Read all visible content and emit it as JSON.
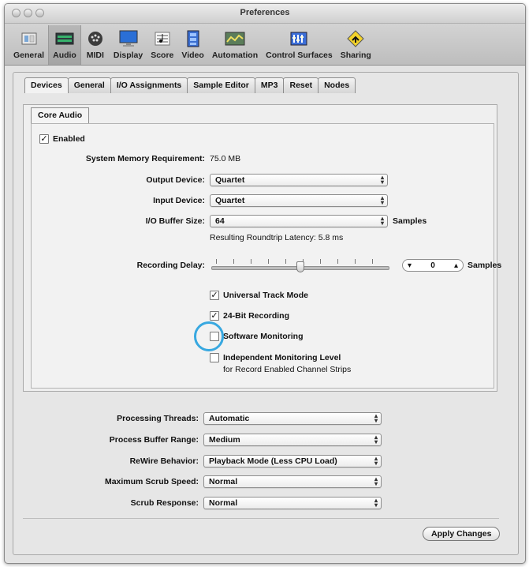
{
  "window": {
    "title": "Preferences"
  },
  "toolbar": {
    "items": [
      {
        "label": "General",
        "icon": "general-icon"
      },
      {
        "label": "Audio",
        "icon": "audio-icon",
        "selected": true
      },
      {
        "label": "MIDI",
        "icon": "midi-icon"
      },
      {
        "label": "Display",
        "icon": "display-icon"
      },
      {
        "label": "Score",
        "icon": "score-icon"
      },
      {
        "label": "Video",
        "icon": "video-icon"
      },
      {
        "label": "Automation",
        "icon": "automation-icon"
      },
      {
        "label": "Control Surfaces",
        "icon": "control-surfaces-icon"
      },
      {
        "label": "Sharing",
        "icon": "sharing-icon"
      }
    ]
  },
  "tabs": [
    {
      "label": "Devices",
      "active": true
    },
    {
      "label": "General"
    },
    {
      "label": "I/O Assignments"
    },
    {
      "label": "Sample Editor"
    },
    {
      "label": "MP3"
    },
    {
      "label": "Reset"
    },
    {
      "label": "Nodes"
    }
  ],
  "core_audio": {
    "tab_label": "Core Audio",
    "enabled_label": "Enabled",
    "enabled_checked": true,
    "memory_label": "System Memory Requirement:",
    "memory_value": "75.0 MB",
    "output_device_label": "Output Device:",
    "output_device_value": "Quartet",
    "input_device_label": "Input Device:",
    "input_device_value": "Quartet",
    "buffer_label": "I/O Buffer Size:",
    "buffer_value": "64",
    "buffer_unit": "Samples",
    "latency_text": "Resulting Roundtrip Latency: 5.8 ms",
    "recording_delay_label": "Recording Delay:",
    "recording_delay_value": "0",
    "recording_delay_unit": "Samples",
    "universal_track_mode_label": "Universal Track Mode",
    "universal_track_mode_checked": true,
    "bit24_label": "24-Bit Recording",
    "bit24_checked": true,
    "software_monitoring_label": "Software Monitoring",
    "software_monitoring_checked": false,
    "independent_monitoring_label": "Independent Monitoring Level",
    "independent_monitoring_sub": "for Record Enabled Channel Strips",
    "independent_monitoring_checked": false,
    "highlight_color": "#38a8e0"
  },
  "general": {
    "processing_threads_label": "Processing Threads:",
    "processing_threads_value": "Automatic",
    "process_buffer_label": "Process Buffer Range:",
    "process_buffer_value": "Medium",
    "rewire_label": "ReWire Behavior:",
    "rewire_value": "Playback Mode (Less CPU Load)",
    "max_scrub_label": "Maximum Scrub Speed:",
    "max_scrub_value": "Normal",
    "scrub_response_label": "Scrub Response:",
    "scrub_response_value": "Normal"
  },
  "apply_button": "Apply Changes"
}
